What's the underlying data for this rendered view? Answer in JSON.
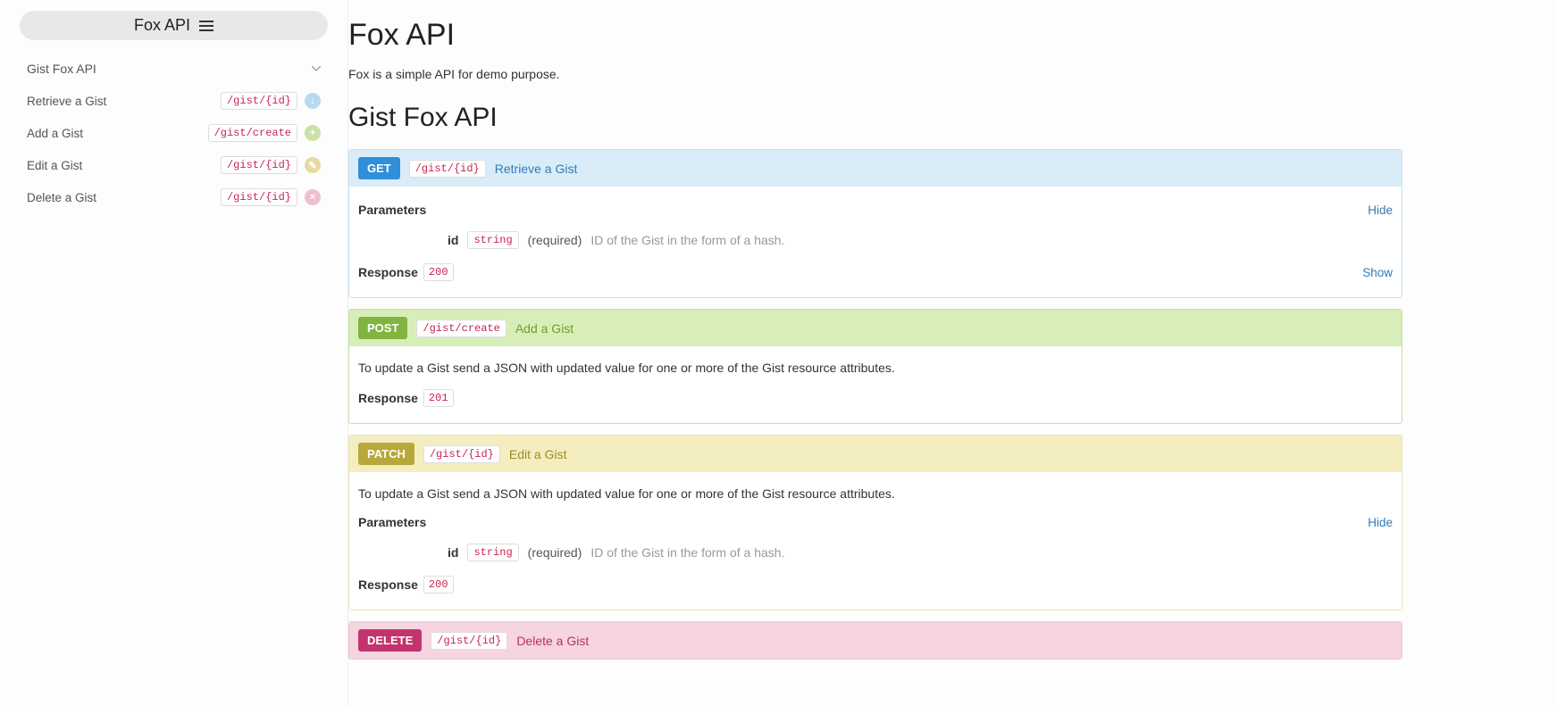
{
  "sidebar": {
    "title": "Fox API",
    "group": "Gist Fox API",
    "items": [
      {
        "label": "Retrieve a Gist",
        "path": "/gist/{id}",
        "method": "GET"
      },
      {
        "label": "Add a Gist",
        "path": "/gist/create",
        "method": "POST"
      },
      {
        "label": "Edit a Gist",
        "path": "/gist/{id}",
        "method": "PATCH"
      },
      {
        "label": "Delete a Gist",
        "path": "/gist/{id}",
        "method": "DELETE"
      }
    ]
  },
  "page": {
    "title": "Fox API",
    "description": "Fox is a simple API for demo purpose.",
    "section_title": "Gist Fox API"
  },
  "labels": {
    "parameters": "Parameters",
    "response": "Response",
    "hide": "Hide",
    "show": "Show",
    "required": "(required)"
  },
  "endpoints": [
    {
      "method": "GET",
      "path": "/gist/{id}",
      "title": "Retrieve a Gist",
      "param": {
        "name": "id",
        "type": "string",
        "desc": "ID of the Gist in the form of a hash."
      },
      "response_code": "200"
    },
    {
      "method": "POST",
      "path": "/gist/create",
      "title": "Add a Gist",
      "desc": "To update a Gist send a JSON with updated value for one or more of the Gist resource attributes.",
      "response_code": "201"
    },
    {
      "method": "PATCH",
      "path": "/gist/{id}",
      "title": "Edit a Gist",
      "desc": "To update a Gist send a JSON with updated value for one or more of the Gist resource attributes.",
      "param": {
        "name": "id",
        "type": "string",
        "desc": "ID of the Gist in the form of a hash."
      },
      "response_code": "200"
    },
    {
      "method": "DELETE",
      "path": "/gist/{id}",
      "title": "Delete a Gist"
    }
  ]
}
